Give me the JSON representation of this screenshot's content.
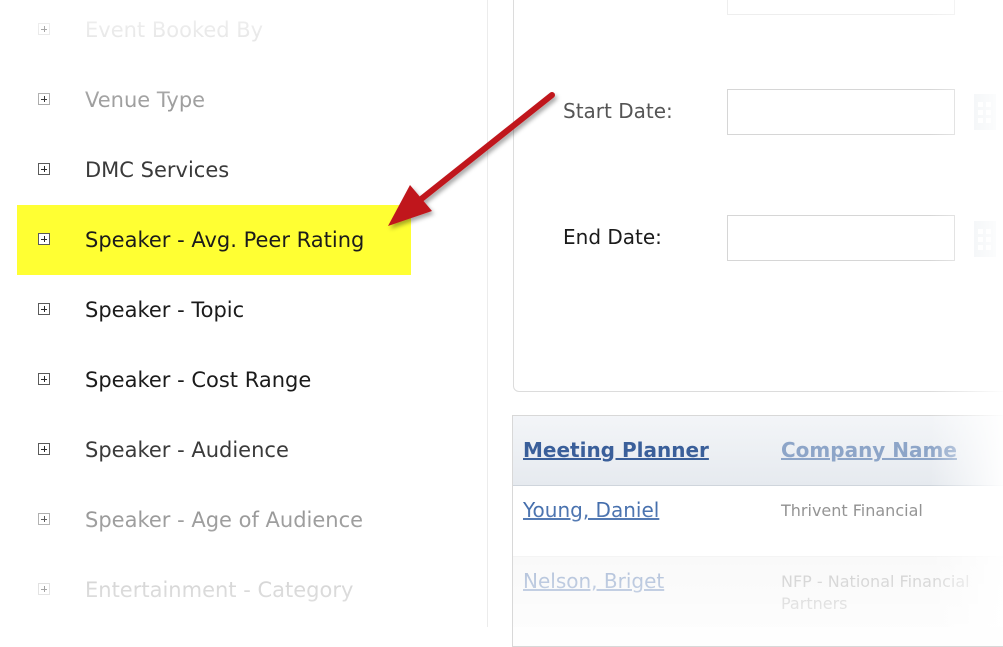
{
  "filter_panel": {
    "items": [
      {
        "label": "Event Booked By"
      },
      {
        "label": "Venue Type"
      },
      {
        "label": "DMC Services"
      },
      {
        "label": "Speaker - Avg. Peer Rating"
      },
      {
        "label": "Speaker - Topic"
      },
      {
        "label": "Speaker - Cost Range"
      },
      {
        "label": "Speaker - Audience"
      },
      {
        "label": "Speaker - Age of Audience"
      },
      {
        "label": "Entertainment - Category"
      }
    ],
    "highlight_color": "#ffff33"
  },
  "form": {
    "start_date_label": "Start Date:",
    "start_date_value": "",
    "end_date_label": "End Date:",
    "end_date_value": ""
  },
  "grid": {
    "columns": [
      {
        "label": "Meeting Planner"
      },
      {
        "label": "Company Name"
      }
    ],
    "rows": [
      {
        "planner": "Young, Daniel",
        "company": "Thrivent Financial"
      },
      {
        "planner": "Nelson, Briget",
        "company": "NFP - National Financial Partners"
      }
    ]
  },
  "annotation": {
    "arrow_color": "#c0181e"
  }
}
